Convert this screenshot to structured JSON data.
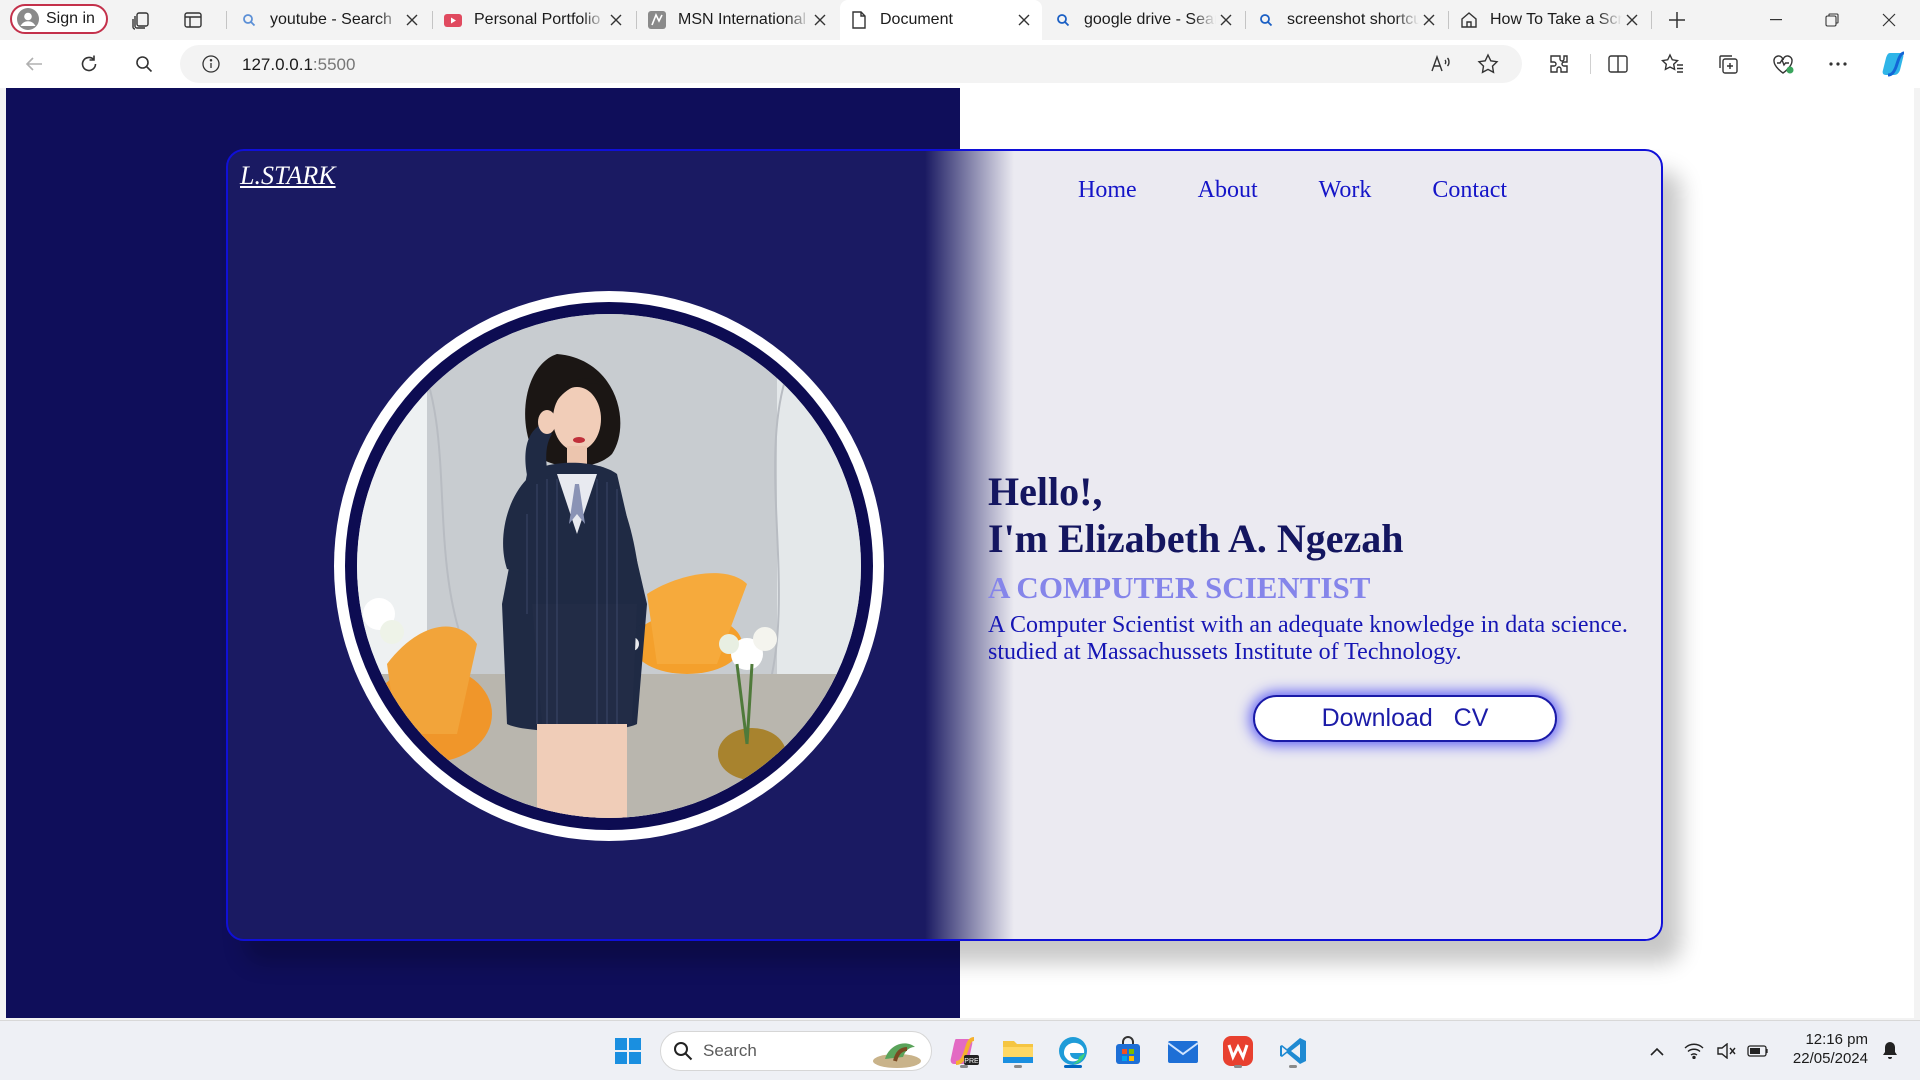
{
  "browser": {
    "sign_in_label": "Sign in",
    "tabs": [
      {
        "title": "youtube - Search",
        "icon": "search-icon",
        "active": false
      },
      {
        "title": "Personal Portfolio",
        "icon": "youtube-icon",
        "active": false
      },
      {
        "title": "MSN International",
        "icon": "msn-icon",
        "active": false
      },
      {
        "title": "Document",
        "icon": "document-icon",
        "active": true
      },
      {
        "title": "google drive - Search",
        "icon": "search-icon",
        "active": false
      },
      {
        "title": "screenshot shortcut",
        "icon": "search-icon",
        "active": false
      },
      {
        "title": "How To Take a Screenshot",
        "icon": "house-icon",
        "active": false
      }
    ],
    "address": {
      "host": "127.0.0.1",
      "port": ":5500"
    }
  },
  "page": {
    "logo": "L.STARK",
    "nav": [
      "Home",
      "About",
      "Work",
      "Contact"
    ],
    "greeting_line1": "Hello!,",
    "greeting_line2": "I'm Elizabeth A. Ngezah",
    "role": "A COMPUTER SCIENTIST",
    "description_line1": "A Computer Scientist with an adequate knowledge in data science.",
    "description_line2": "studied at Massachussets Institute of Technology.",
    "cv_button": "Download   CV",
    "colors": {
      "navy": "#0f0e5a",
      "accent_blue": "#1010d8",
      "role_purple": "#8585ea",
      "panel_light": "#ebeaf1"
    }
  },
  "taskbar": {
    "search_placeholder": "Search",
    "time": "12:16 pm",
    "date": "22/05/2024"
  }
}
